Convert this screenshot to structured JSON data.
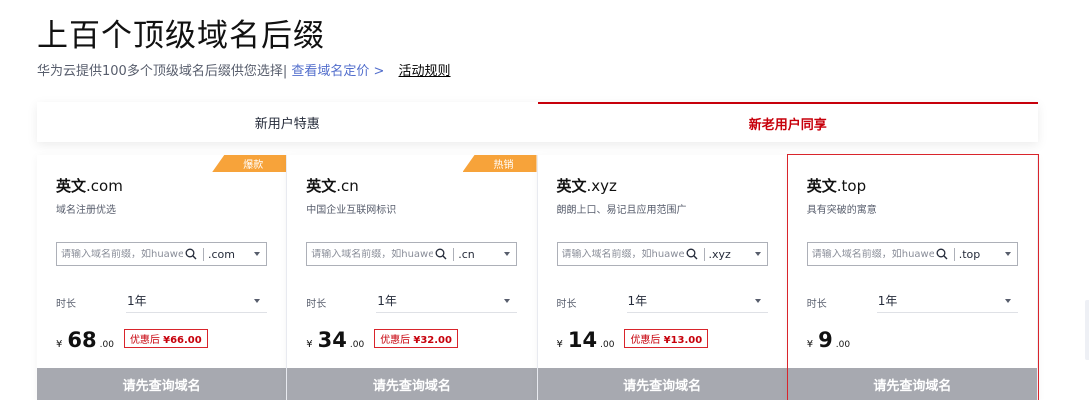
{
  "header": {
    "title": "上百个顶级域名后缀",
    "subtitle": "华为云提供100多个顶级域名后缀供您选择|",
    "pricing_link": "查看域名定价 >",
    "rules_link": "活动规则"
  },
  "tabs": [
    {
      "label": "新用户特惠",
      "active": false
    },
    {
      "label": "新老用户同享",
      "active": true
    }
  ],
  "accent_color": "#c7000b",
  "cards": [
    {
      "name_cn": "英文",
      "tld": ".com",
      "desc": "域名注册优选",
      "badge": "爆款",
      "search_placeholder": "请输入域名前缀，如huaweicloud",
      "suffix": ".com",
      "duration_label": "时长",
      "duration": "1年",
      "currency": "¥",
      "price_int": "68",
      "price_dec": ".00",
      "promo_label": "优惠后",
      "promo_price": "¥66.00",
      "button": "请先查询域名"
    },
    {
      "name_cn": "英文",
      "tld": ".cn",
      "desc": "中国企业互联网标识",
      "badge": "热销",
      "search_placeholder": "请输入域名前缀，如huaweicloud",
      "suffix": ".cn",
      "duration_label": "时长",
      "duration": "1年",
      "currency": "¥",
      "price_int": "34",
      "price_dec": ".00",
      "promo_label": "优惠后",
      "promo_price": "¥32.00",
      "button": "请先查询域名"
    },
    {
      "name_cn": "英文",
      "tld": ".xyz",
      "desc": "朗朗上口、易记且应用范围广",
      "badge": "",
      "search_placeholder": "请输入域名前缀，如huaweicloud",
      "suffix": ".xyz",
      "duration_label": "时长",
      "duration": "1年",
      "currency": "¥",
      "price_int": "14",
      "price_dec": ".00",
      "promo_label": "优惠后",
      "promo_price": "¥13.00",
      "button": "请先查询域名"
    },
    {
      "name_cn": "英文",
      "tld": ".top",
      "desc": "具有突破的寓意",
      "badge": "",
      "search_placeholder": "请输入域名前缀，如huaweicloud",
      "suffix": ".top",
      "duration_label": "时长",
      "duration": "1年",
      "currency": "¥",
      "price_int": "9",
      "price_dec": ".00",
      "promo_label": "",
      "promo_price": "",
      "button": "请先查询域名"
    }
  ]
}
